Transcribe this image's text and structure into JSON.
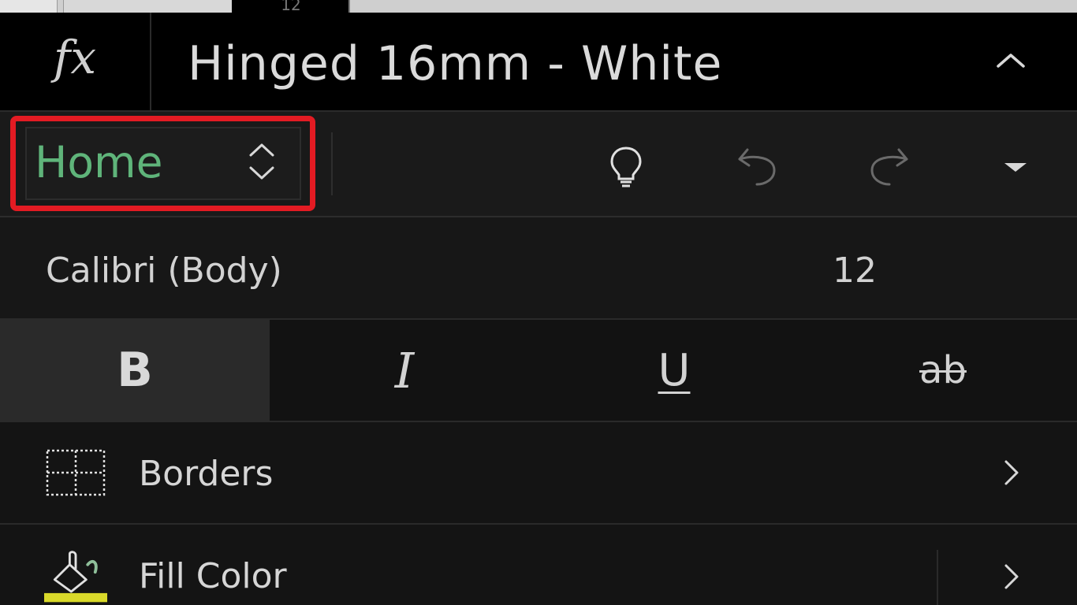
{
  "top_strip": {
    "visible_text": "12"
  },
  "formula_bar": {
    "fx_label": "fx",
    "value": "Hinged 16mm - White",
    "collapse_icon": "chevron-up-icon"
  },
  "toolbar": {
    "tab_selector": {
      "label": "Home",
      "icon": "up-down-chevron-icon",
      "highlight_color": "#e31b23",
      "label_color": "#5fb47a"
    },
    "icons": [
      "lightbulb-icon",
      "undo-icon",
      "redo-icon",
      "dropdown-triangle-icon"
    ]
  },
  "font": {
    "name": "Calibri (Body)",
    "size": "12"
  },
  "format_buttons": {
    "bold": "B",
    "italic": "I",
    "underline": "U",
    "strikethrough": "ab"
  },
  "list": [
    {
      "label": "Borders",
      "icon": "borders-icon"
    },
    {
      "label": "Fill Color",
      "icon": "fill-color-icon",
      "swatch_color": "#d9d92a"
    }
  ]
}
